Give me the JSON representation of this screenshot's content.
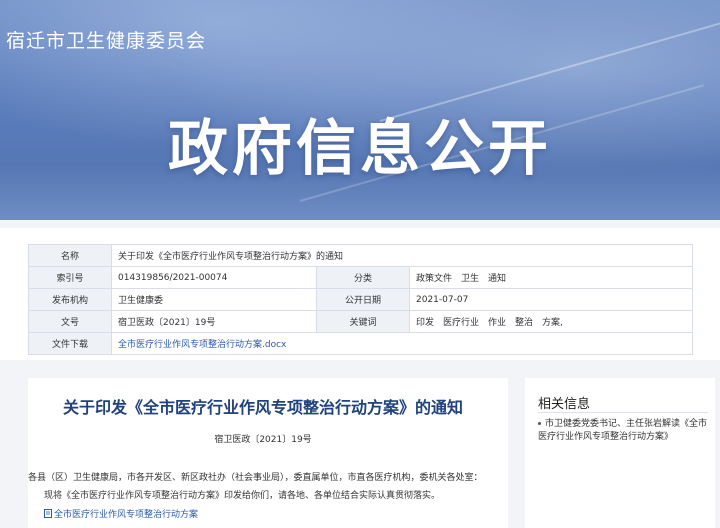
{
  "header": {
    "site_name": "宿迁市卫生健康委员会",
    "banner_title": "政府信息公开"
  },
  "meta": {
    "name_label": "名称",
    "name_value": "关于印发《全市医疗行业作风专项整治行动方案》的通知",
    "index_label": "索引号",
    "index_value": "014319856/2021-00074",
    "category_label": "分类",
    "category_value": "政策文件　卫生　通知",
    "org_label": "发布机构",
    "org_value": "卫生健康委",
    "date_label": "公开日期",
    "date_value": "2021-07-07",
    "docno_label": "文号",
    "docno_value": "宿卫医政〔2021〕19号",
    "keywords_label": "关键词",
    "keywords_value": "印发　医疗行业　作业　整治　方案,",
    "download_label": "文件下载",
    "download_value": "全市医疗行业作风专项整治行动方案.docx"
  },
  "document": {
    "title": "关于印发《全市医疗行业作风专项整治行动方案》的通知",
    "doc_number": "宿卫医政〔2021〕19号",
    "para1": "各县（区）卫生健康局，市各开发区、新区政社办（社会事业局），委直属单位，市直各医疗机构，委机关各处室：",
    "para2": "现将《全市医疗行业作风专项整治行动方案》印发给你们，请各地、各单位结合实际认真贯彻落实。",
    "attachment": "全市医疗行业作风专项整治行动方案"
  },
  "sidebar": {
    "title": "相关信息",
    "items": [
      "市卫健委党委书记、主任张岩解读《全市医疗行业作风专项整治行动方案》"
    ]
  },
  "colors": {
    "banner_blue": "#5d7fbd",
    "title_blue": "#20427d",
    "link_blue": "#2b5aa8"
  }
}
